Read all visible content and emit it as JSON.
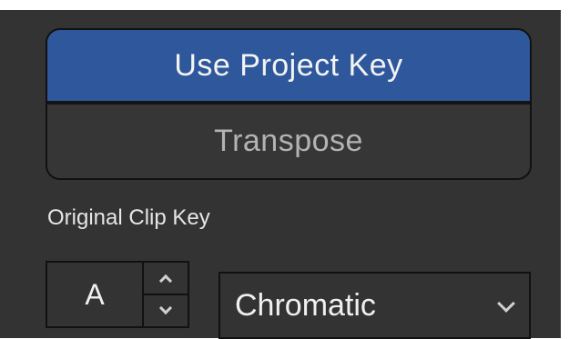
{
  "mode_group": {
    "use_project_key_label": "Use Project Key",
    "transpose_label": "Transpose",
    "selected": "Use Project Key"
  },
  "original_clip_key": {
    "label": "Original Clip Key",
    "key_value": "A",
    "scale_value": "Chromatic"
  },
  "icons": {
    "increment": "chevron-up-icon",
    "decrement": "chevron-down-icon",
    "dropdown": "chevron-down-icon"
  },
  "colors": {
    "panel_background": "#333333",
    "selected_background": "#2e579c",
    "border": "#111111",
    "selected_text": "#f3f3f3",
    "unselected_text": "#b3b3b3"
  }
}
